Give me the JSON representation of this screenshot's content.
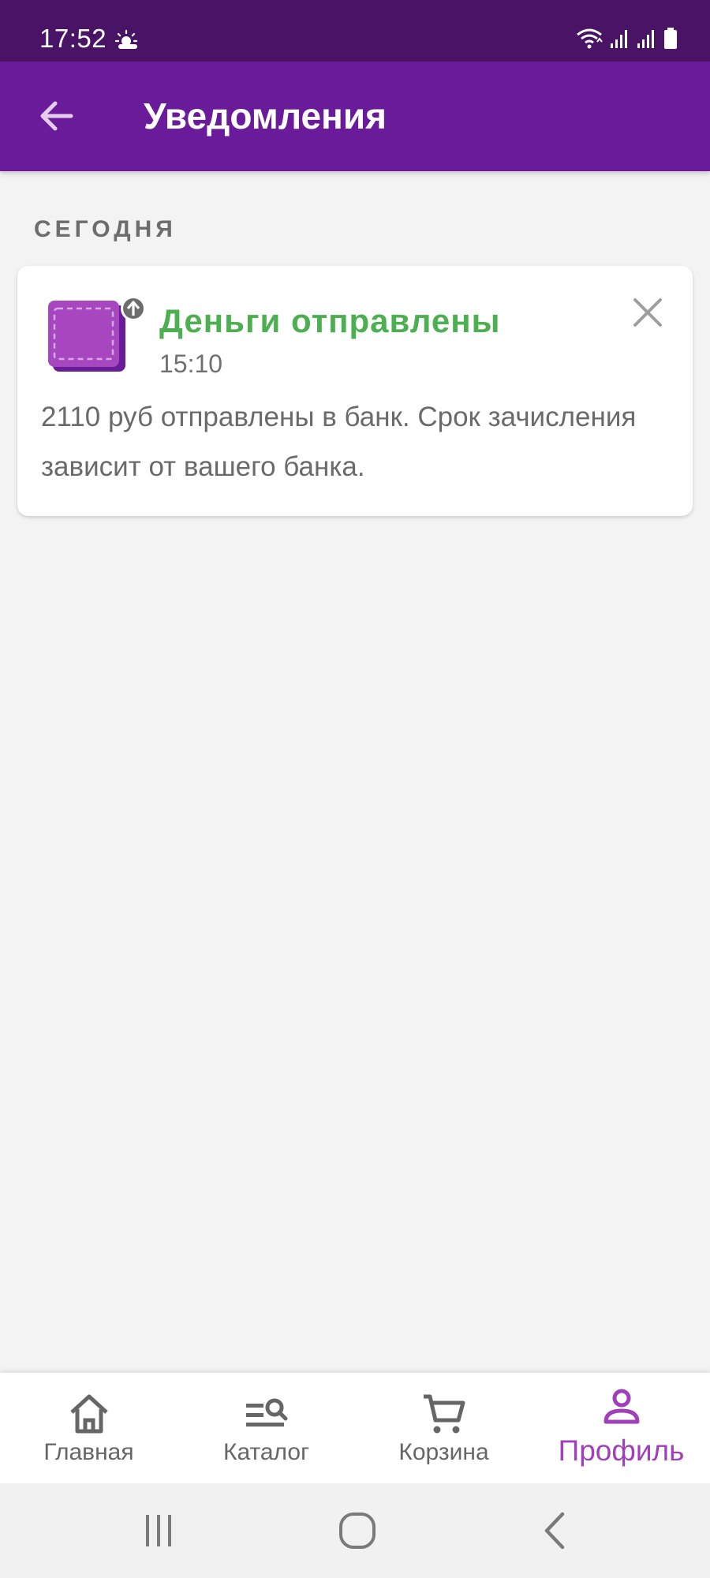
{
  "status_bar": {
    "time": "17:52",
    "weather_icon": "sun-cloud-icon",
    "right_icons": [
      "wifi-icon",
      "signal-icon",
      "signal-icon",
      "battery-icon"
    ]
  },
  "app_bar": {
    "title": "Уведомления",
    "back_icon": "arrow-left-icon",
    "background": "#6a1b9a"
  },
  "section": {
    "header": "СЕГОДНЯ"
  },
  "notification": {
    "icon": "wallet-upload-icon",
    "title": "Деньги отправлены",
    "time": "15:10",
    "text": "2110 руб отправлены в банк. Срок зачисления зависит от вашего банка.",
    "title_color": "#4caf50",
    "close_icon": "close-icon"
  },
  "bottom_nav": {
    "items": [
      {
        "label": "Главная",
        "icon": "home-icon",
        "active": false
      },
      {
        "label": "Каталог",
        "icon": "catalog-search-icon",
        "active": false
      },
      {
        "label": "Корзина",
        "icon": "cart-icon",
        "active": false
      },
      {
        "label": "Профиль",
        "icon": "profile-icon",
        "active": true
      }
    ],
    "active_color": "#a040b8"
  },
  "system_nav": {
    "icons": [
      "recent-apps-icon",
      "home-circle-icon",
      "back-chevron-icon"
    ]
  }
}
